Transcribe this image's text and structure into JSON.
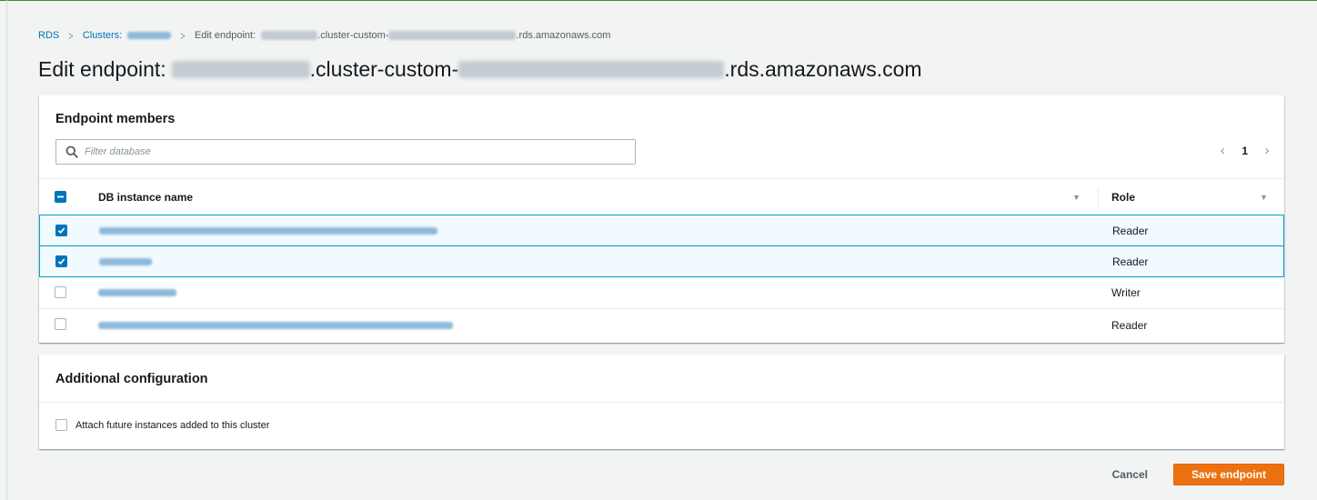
{
  "breadcrumb": {
    "root": "RDS",
    "clusters_prefix": "Clusters:",
    "current_prefix": "Edit endpoint:",
    "current_mid": ".cluster-custom-",
    "current_suffix": ".rds.amazonaws.com"
  },
  "page_title": {
    "prefix": "Edit endpoint:",
    "mid": ".cluster-custom-",
    "suffix": ".rds.amazonaws.com"
  },
  "members": {
    "heading": "Endpoint members",
    "filter_placeholder": "Filter database",
    "page_number": "1",
    "columns": {
      "name": "DB instance name",
      "role": "Role"
    },
    "rows": [
      {
        "selected": true,
        "role": "Reader"
      },
      {
        "selected": true,
        "role": "Reader"
      },
      {
        "selected": false,
        "role": "Writer"
      },
      {
        "selected": false,
        "role": "Reader"
      }
    ]
  },
  "config": {
    "heading": "Additional configuration",
    "attach_label": "Attach future instances added to this cluster",
    "attach_checked": false
  },
  "actions": {
    "cancel": "Cancel",
    "save": "Save endpoint"
  },
  "colors": {
    "link": "#0073bb",
    "primary_button": "#ec7211",
    "selected_row_bg": "#f1faff",
    "selected_row_border": "#00a1c9"
  }
}
